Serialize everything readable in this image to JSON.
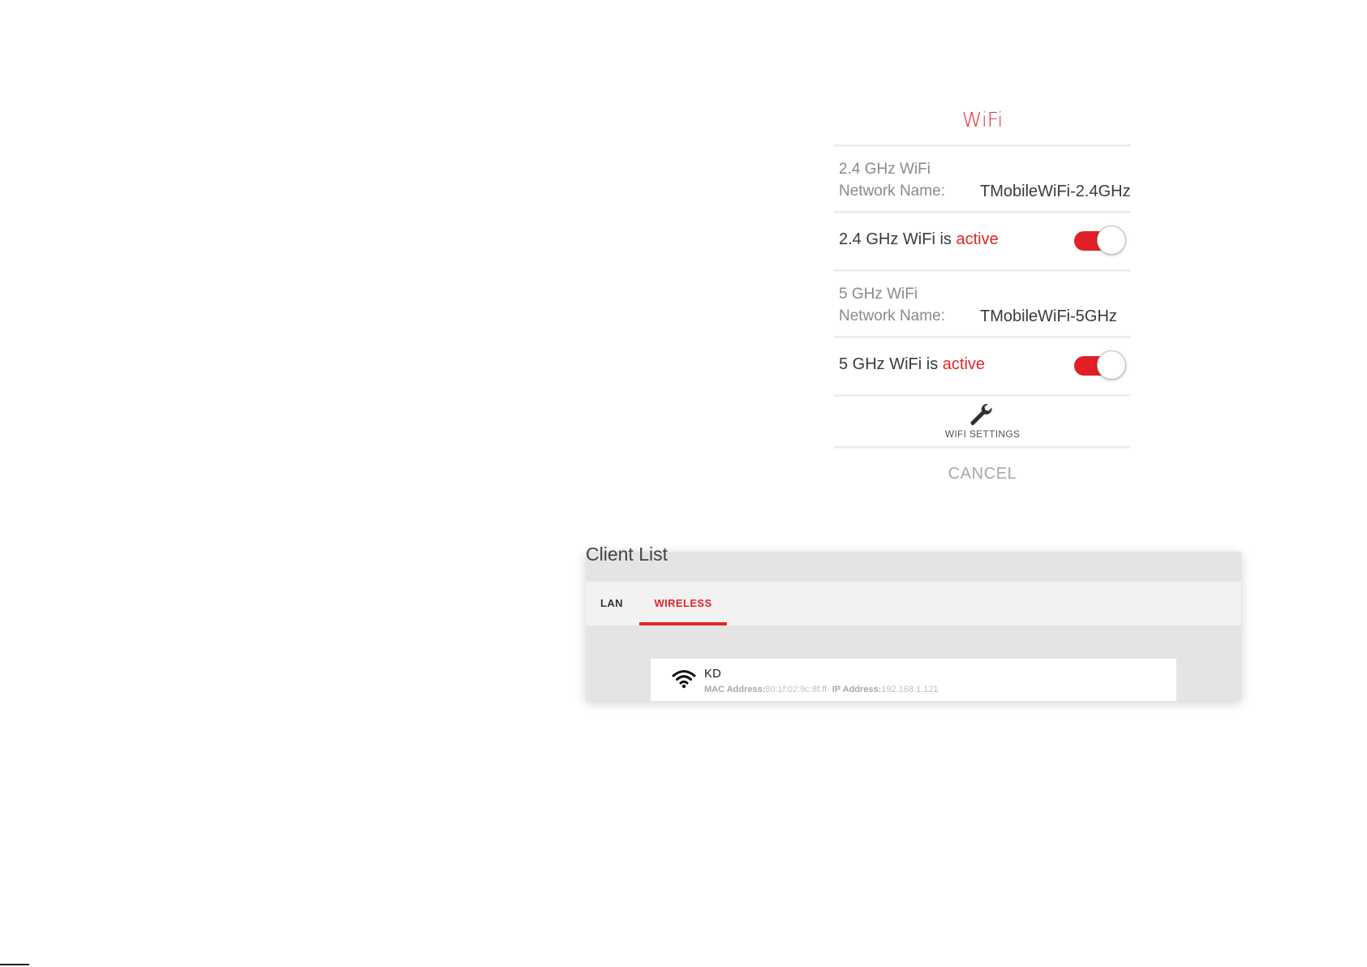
{
  "wifi_panel": {
    "title": "WiFi",
    "band_24": {
      "heading": "2.4 GHz WiFi",
      "network_name_label": "Network Name:",
      "network_name_value": "TMobileWiFi-2.4GHz",
      "status_prefix": "2.4 GHz WiFi is ",
      "status_value": "active",
      "toggle_on": true
    },
    "band_5": {
      "heading": "5 GHz WiFi",
      "network_name_label": "Network Name:",
      "network_name_value": "TMobileWiFi-5GHz",
      "status_prefix": "5 GHz WiFi is ",
      "status_value": "active",
      "toggle_on": true
    },
    "settings_label": "WIFI SETTINGS",
    "settings_icon": "wrench-icon",
    "cancel_label": "CANCEL"
  },
  "client_list": {
    "title": "Client List",
    "tabs": [
      {
        "label": "LAN",
        "selected": false
      },
      {
        "label": "WIRELESS",
        "selected": true
      }
    ],
    "clients": [
      {
        "icon": "wifi-icon",
        "name": "KD",
        "mac_label": "MAC Address:",
        "mac_value": "80:1f:02:9c:8f:ff·",
        "ip_label": "IP Address:",
        "ip_value": "192.168.1.121"
      }
    ]
  },
  "colors": {
    "accent": "#e02727",
    "toggle_on": "#e21f26",
    "muted_text": "#8a8a8a"
  }
}
